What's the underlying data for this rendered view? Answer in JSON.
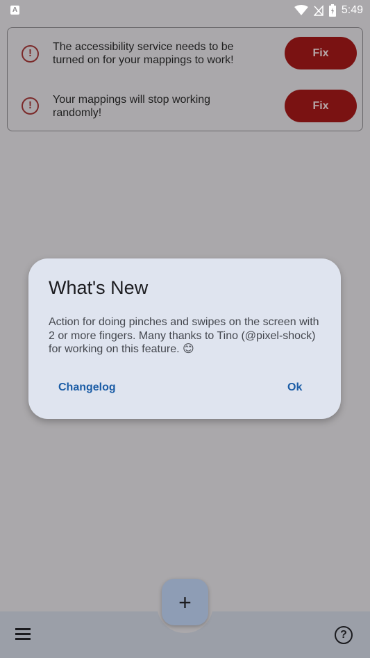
{
  "status_bar": {
    "time": "5:49",
    "left_icon": "A",
    "icons": [
      "wifi-icon",
      "no-signal-icon",
      "battery-icon"
    ]
  },
  "warnings": [
    {
      "icon": "error-icon",
      "text": "The accessibility service needs to be turned on for your mappings to work!",
      "action_label": "Fix"
    },
    {
      "icon": "error-icon",
      "text": "Your mappings will stop working randomly!",
      "action_label": "Fix"
    }
  ],
  "dialog": {
    "title": "What's New",
    "body": "Action for doing pinches and swipes on the screen with 2 or more fingers. Many thanks to Tino (@pixel-shock) for working on this feature. 😊",
    "buttons": {
      "changelog": "Changelog",
      "ok": "Ok"
    }
  },
  "bottom_bar": {
    "menu_icon": "menu-icon",
    "fab_label": "+",
    "help_icon": "help-icon"
  },
  "colors": {
    "scrim_background": "#aaa8ab",
    "fix_button": "#7a1212",
    "dialog_background": "#dfe4ef",
    "dialog_button_text": "#1c5da6",
    "fab": "#8e9db5",
    "bottom_bar": "#9b9fa8"
  }
}
